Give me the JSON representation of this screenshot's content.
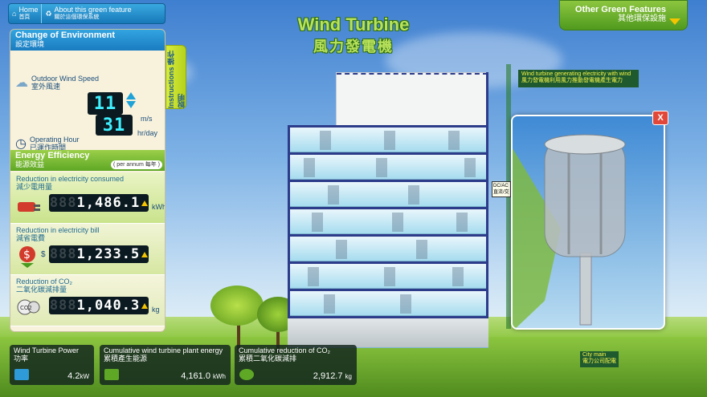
{
  "nav": {
    "home_en": "Home",
    "home_zh": "首頁",
    "about_en": "About this green feature",
    "about_zh": "關於這個環保系統"
  },
  "other_features": {
    "en": "Other Green Features",
    "zh": "其他環保設施"
  },
  "title": {
    "en": "Wind Turbine",
    "zh": "風力發電機"
  },
  "env": {
    "head_en": "Change of Environment",
    "head_zh": "設定環境",
    "wind_en": "Outdoor Wind Speed",
    "wind_zh": "室外風速",
    "wind_value": "11",
    "wind_unit": "m/s",
    "hour_en": "Operating Hour",
    "hour_zh": "已運作時間",
    "hour_value": "31",
    "hour_unit": "hr/day"
  },
  "efficiency": {
    "head_en": "Energy Efficiency",
    "head_zh": "能源效益",
    "per_annum": "( per annum 每年 )",
    "items": [
      {
        "en": "Reduction in electricity consumed",
        "zh": "減少電用量",
        "dim": "888",
        "value": "1,486.1",
        "unit": "kWh",
        "prefix": ""
      },
      {
        "en": "Reduction in electricity bill",
        "zh": "減省電費",
        "dim": "888",
        "value": "1,233.5",
        "unit": "",
        "prefix": "$"
      },
      {
        "en": "Reduction of CO₂",
        "zh": "二氧化碳減排量",
        "dim": "888",
        "value": "1,040.3",
        "unit": "kg",
        "prefix": ""
      }
    ]
  },
  "instructions": "Instructions 操作說明",
  "stats": [
    {
      "en": "Wind Turbine Power",
      "zh": "功率",
      "value": "4.2",
      "unit": "kW"
    },
    {
      "en": "Cumulative wind turbine plant energy",
      "zh": "累積產生能源",
      "value": "4,161.0",
      "unit": "kWh"
    },
    {
      "en": "Cumulative reduction of CO₂",
      "zh": "累積二氧化碳減排",
      "value": "2,912.7",
      "unit": "kg"
    }
  ],
  "callout": {
    "en": "Wind turbine generating electricity with wind",
    "zh": "風力發電機利用風力推動發電機產生電力"
  },
  "dcac": "DC/AC 直流/交",
  "city_main": {
    "en": "City main",
    "zh": "電力公司配電"
  },
  "close_label": "X"
}
